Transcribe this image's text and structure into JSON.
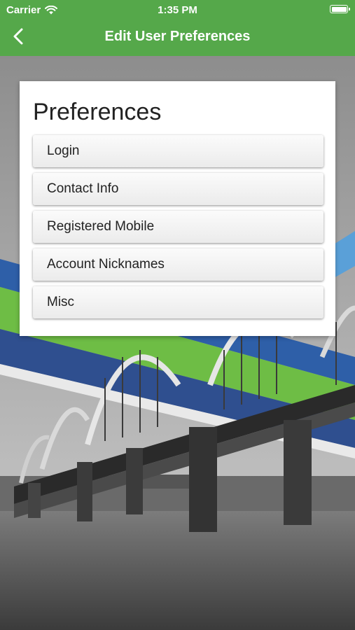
{
  "status_bar": {
    "carrier": "Carrier",
    "time": "1:35 PM"
  },
  "nav": {
    "title": "Edit User Preferences",
    "back_icon": "chevron-left-icon"
  },
  "panel": {
    "heading": "Preferences",
    "items": [
      {
        "label": "Login"
      },
      {
        "label": "Contact Info"
      },
      {
        "label": "Registered Mobile"
      },
      {
        "label": "Account Nicknames"
      },
      {
        "label": "Misc"
      }
    ]
  },
  "colors": {
    "brand_green": "#55a84a",
    "accent_blue": "#2e5fa8"
  },
  "background": {
    "subject": "bridge-photo"
  }
}
